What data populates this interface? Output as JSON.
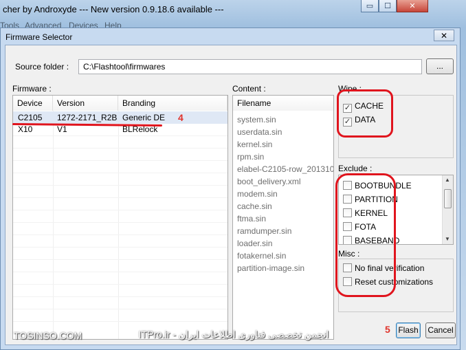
{
  "parent": {
    "title": "cher by Androxyde    --- New version 0.9.18.6 available ---",
    "menu": [
      "Tools",
      "Advanced",
      "Devices",
      "Help"
    ],
    "minimize_glyph": "▭",
    "maximize_glyph": "☐",
    "close_glyph": "✕"
  },
  "dialog": {
    "title": "Firmware Selector",
    "close_glyph": "✕"
  },
  "source": {
    "label": "Source folder :",
    "value": "C:\\Flashtool\\firmwares",
    "browse_label": "..."
  },
  "firmware": {
    "label": "Firmware :",
    "columns": [
      "Device",
      "Version",
      "Branding"
    ],
    "rows": [
      {
        "device": "C2105",
        "version": "1272-2171_R2B",
        "branding": "Generic DE"
      },
      {
        "device": "X10",
        "version": "V1",
        "branding": "BLRelock"
      }
    ]
  },
  "content": {
    "label": "Content :",
    "header": "Filename",
    "files": [
      "system.sin",
      "userdata.sin",
      "kernel.sin",
      "rpm.sin",
      "elabel-C2105-row_201310...",
      "boot_delivery.xml",
      "modem.sin",
      "cache.sin",
      "ftma.sin",
      "ramdumper.sin",
      "loader.sin",
      "fotakernel.sin",
      "partition-image.sin"
    ]
  },
  "wipe": {
    "label": "Wipe :",
    "items": [
      {
        "label": "CACHE",
        "checked": "✓"
      },
      {
        "label": "DATA",
        "checked": "✓"
      }
    ]
  },
  "exclude": {
    "label": "Exclude :",
    "items": [
      {
        "label": "BOOTBUNDLE"
      },
      {
        "label": "PARTITION"
      },
      {
        "label": "KERNEL"
      },
      {
        "label": "FOTA"
      },
      {
        "label": "BASEBAND"
      }
    ]
  },
  "misc": {
    "label": "Misc :",
    "items": [
      {
        "label": "No final verification"
      },
      {
        "label": "Reset customizations"
      }
    ]
  },
  "buttons": {
    "flash": "Flash",
    "cancel": "Cancel"
  },
  "annotations": {
    "step4": "4",
    "step5": "5",
    "annotation_color": "#e0141d"
  },
  "watermark": {
    "left": "TOSINSO.COM",
    "right": "ITPro.ir - انجمن تخصصی فناوری اطلاعات ایران"
  }
}
